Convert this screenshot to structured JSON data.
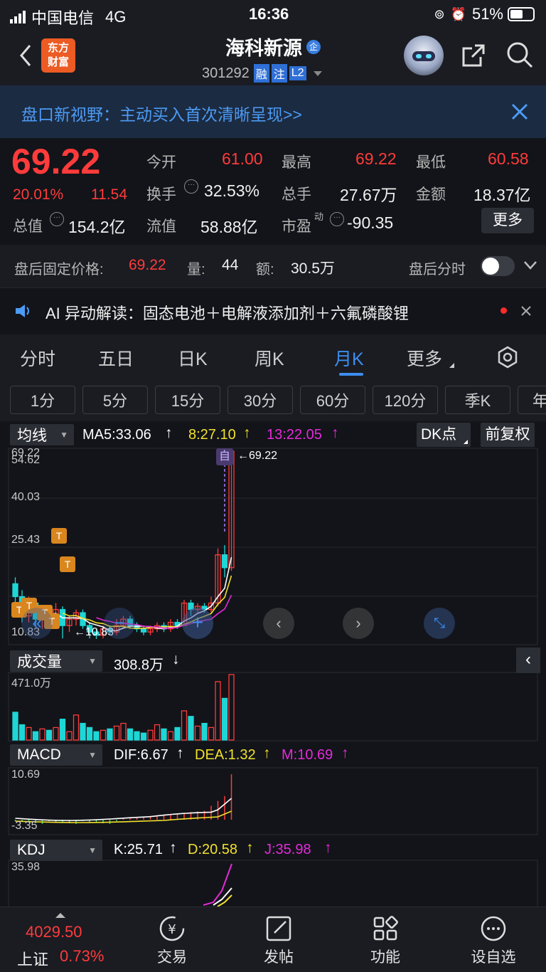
{
  "status": {
    "carrier": "中国电信",
    "network": "4G",
    "time": "16:36",
    "battery": "51%"
  },
  "nav": {
    "logo_line1": "东方",
    "logo_line2": "财富",
    "stock_name": "海科新源",
    "badge": "企",
    "code": "301292",
    "tag_rong": "融",
    "tag_zhu": "注",
    "tag_l2": "L2"
  },
  "banner": {
    "text": "盘口新视野：主动买入首次清晰呈现>>"
  },
  "quote": {
    "price": "69.22",
    "pct": "20.01%",
    "chg": "11.54",
    "open_label": "今开",
    "open": "61.00",
    "high_label": "最高",
    "high": "69.22",
    "low_label": "最低",
    "low": "60.58",
    "turnover_label": "换手",
    "turnover": "32.53%",
    "volume_label": "总手",
    "volume": "27.67万",
    "amount_label": "金额",
    "amount": "18.37亿",
    "mktcap_label": "总值",
    "mktcap": "154.2亿",
    "float_label": "流值",
    "float": "58.88亿",
    "pe_label": "市盈",
    "pe_sup": "动",
    "pe": "-90.35",
    "more": "更多"
  },
  "after": {
    "label": "盘后固定价格:",
    "price": "69.22",
    "vol_label": "量:",
    "vol": "44",
    "amt_label": "额:",
    "amt": "30.5万",
    "toggle_label": "盘后分时"
  },
  "ai": {
    "text": "AI 异动解读：固态电池＋电解液添加剂＋六氟磷酸锂"
  },
  "periods": {
    "items": [
      "分时",
      "五日",
      "日K",
      "周K",
      "月K",
      "更多"
    ],
    "active": "月K"
  },
  "intervals": {
    "items": [
      "1分",
      "5分",
      "15分",
      "30分",
      "60分",
      "120分",
      "季K",
      "年"
    ]
  },
  "main_chart": {
    "indicator": "均线",
    "ma5": "MA5:33.06",
    "ma8": "8:27.10",
    "ma13": "13:22.05",
    "dk": "DK点",
    "adjust": "前复权",
    "y_top": "69.22",
    "y_2": "54.62",
    "y_3": "40.03",
    "y_4": "25.43",
    "y_bottom": "10.83",
    "max_label": "69.22",
    "min_label": "10.83",
    "self_tag": "自",
    "t_tag": "T"
  },
  "volume_chart": {
    "indicator": "成交量",
    "value": "308.8万",
    "ymax": "471.0万"
  },
  "macd_chart": {
    "indicator": "MACD",
    "dif": "DIF:6.67",
    "dea": "DEA:1.32",
    "m": "M:10.69",
    "ymax": "10.69",
    "ymin": "-3.35"
  },
  "kdj_chart": {
    "indicator": "KDJ",
    "k": "K:25.71",
    "d": "D:20.58",
    "j": "J:35.98",
    "ymax": "35.98"
  },
  "colors": {
    "up": "#ff3b3b",
    "down": "#1fd6d6",
    "ma5": "#ffffff",
    "ma8": "#f2e02c",
    "ma13": "#e52ad9",
    "accent": "#3d8ef0"
  },
  "chart_data": {
    "type": "candlestick",
    "title": "",
    "ylim": [
      10.83,
      69.22
    ],
    "candles": [
      {
        "o": 28,
        "c": 24,
        "h": 30,
        "l": 22
      },
      {
        "o": 24,
        "c": 18,
        "h": 26,
        "l": 16
      },
      {
        "o": 18,
        "c": 22,
        "h": 24,
        "l": 16
      },
      {
        "o": 22,
        "c": 17,
        "h": 23,
        "l": 15
      },
      {
        "o": 17,
        "c": 19,
        "h": 21,
        "l": 14
      },
      {
        "o": 19,
        "c": 16,
        "h": 20,
        "l": 14
      },
      {
        "o": 16,
        "c": 20,
        "h": 22,
        "l": 15
      },
      {
        "o": 20,
        "c": 15,
        "h": 21,
        "l": 11
      },
      {
        "o": 15,
        "c": 17,
        "h": 18,
        "l": 13
      },
      {
        "o": 17,
        "c": 19,
        "h": 20,
        "l": 15
      },
      {
        "o": 19,
        "c": 15,
        "h": 20,
        "l": 14
      },
      {
        "o": 15,
        "c": 13,
        "h": 16,
        "l": 11
      },
      {
        "o": 13,
        "c": 12,
        "h": 14,
        "l": 10.83
      },
      {
        "o": 12,
        "c": 14,
        "h": 15,
        "l": 11
      },
      {
        "o": 14,
        "c": 13,
        "h": 15,
        "l": 12
      },
      {
        "o": 13,
        "c": 15,
        "h": 17,
        "l": 12
      },
      {
        "o": 15,
        "c": 17,
        "h": 18,
        "l": 14
      },
      {
        "o": 17,
        "c": 15,
        "h": 18,
        "l": 14
      },
      {
        "o": 15,
        "c": 14,
        "h": 16,
        "l": 13
      },
      {
        "o": 14,
        "c": 13,
        "h": 15,
        "l": 12
      },
      {
        "o": 13,
        "c": 14,
        "h": 15,
        "l": 12
      },
      {
        "o": 14,
        "c": 15,
        "h": 16,
        "l": 13
      },
      {
        "o": 15,
        "c": 14,
        "h": 16,
        "l": 13
      },
      {
        "o": 14,
        "c": 16,
        "h": 17,
        "l": 13
      },
      {
        "o": 16,
        "c": 15,
        "h": 17,
        "l": 14
      },
      {
        "o": 15,
        "c": 22,
        "h": 23,
        "l": 15
      },
      {
        "o": 22,
        "c": 20,
        "h": 23,
        "l": 18
      },
      {
        "o": 20,
        "c": 21,
        "h": 22,
        "l": 19
      },
      {
        "o": 21,
        "c": 20,
        "h": 22,
        "l": 19
      },
      {
        "o": 20,
        "c": 22,
        "h": 24,
        "l": 19
      },
      {
        "o": 22,
        "c": 37,
        "h": 39,
        "l": 21
      },
      {
        "o": 37,
        "c": 33,
        "h": 40,
        "l": 30
      },
      {
        "o": 33,
        "c": 69.22,
        "h": 69.22,
        "l": 32
      }
    ],
    "volume": [
      200,
      110,
      90,
      60,
      80,
      70,
      90,
      150,
      60,
      180,
      120,
      90,
      60,
      70,
      80,
      100,
      120,
      80,
      60,
      50,
      70,
      110,
      80,
      60,
      90,
      210,
      170,
      100,
      120,
      90,
      420,
      300,
      471
    ]
  }
}
